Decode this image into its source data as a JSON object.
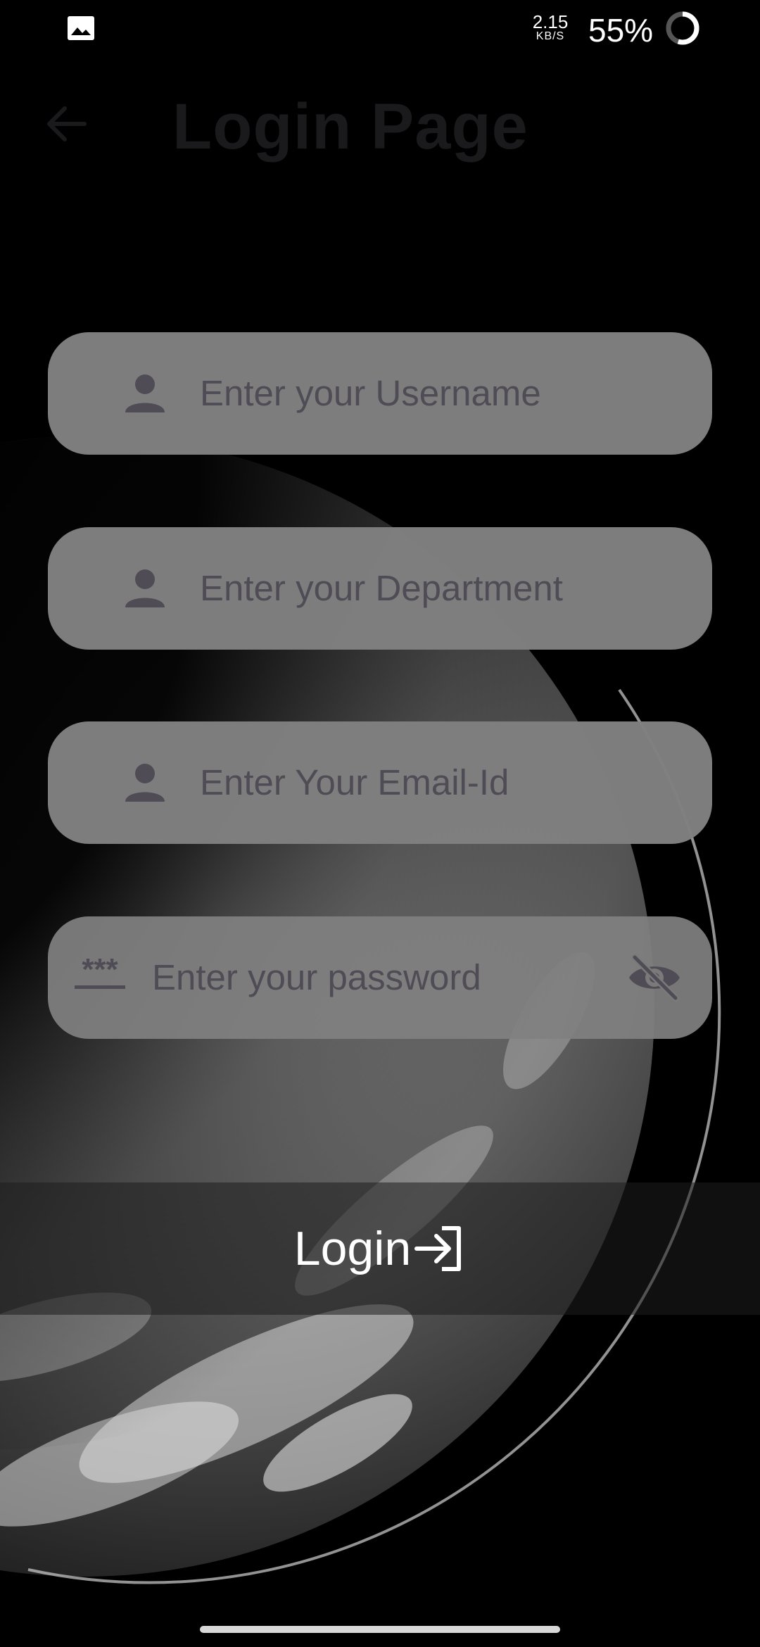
{
  "status_bar": {
    "net_speed_value": "2.15",
    "net_speed_unit": "KB/S",
    "battery_percent": "55%",
    "battery_level": 0.55,
    "notification_icon": "image-icon"
  },
  "app_bar": {
    "title": "Login Page",
    "back_icon": "arrow-left-icon"
  },
  "form": {
    "username": {
      "placeholder": "Enter your Username",
      "value": "",
      "icon": "person-icon"
    },
    "department": {
      "placeholder": "Enter your Department",
      "value": "",
      "icon": "person-icon"
    },
    "email": {
      "placeholder": "Enter Your Email-Id",
      "value": "",
      "icon": "person-icon"
    },
    "password": {
      "placeholder": "Enter your password",
      "value": "",
      "icon": "password-icon",
      "toggle_icon": "visibility-off-icon"
    }
  },
  "login_button": {
    "label": "Login",
    "icon": "login-arrow-icon"
  },
  "colors": {
    "background": "#000000",
    "field_fill": "#808080",
    "placeholder_text": "#4f4c55",
    "title_text": "#1a1a1c",
    "button_text": "#ffffff"
  }
}
